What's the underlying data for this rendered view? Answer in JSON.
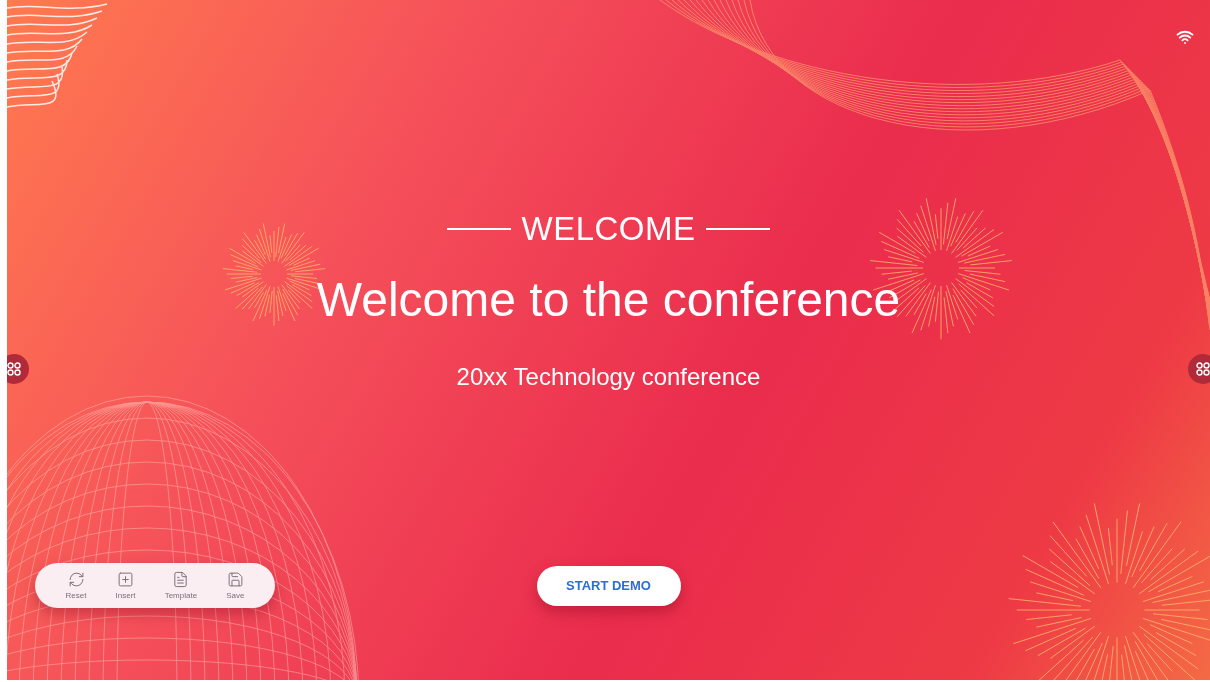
{
  "heading": {
    "label": "WELCOME"
  },
  "title": "Welcome to the conference",
  "subtitle": "20xx Technology conference",
  "toolbar": [
    {
      "kind": "reset",
      "label": "Reset"
    },
    {
      "kind": "insert",
      "label": "Insert"
    },
    {
      "kind": "template",
      "label": "Template"
    },
    {
      "kind": "save",
      "label": "Save"
    }
  ],
  "start_button": "START DEMO"
}
